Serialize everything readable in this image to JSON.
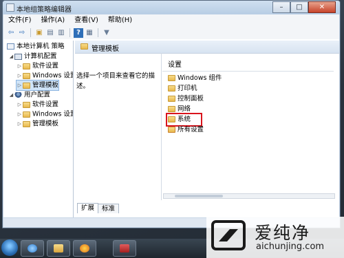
{
  "window": {
    "title": "本地组策略编辑器",
    "controls": {
      "minimize": "–",
      "maximize": "□",
      "close": "✕"
    }
  },
  "menubar": [
    {
      "label": "文件(F)"
    },
    {
      "label": "操作(A)"
    },
    {
      "label": "查看(V)"
    },
    {
      "label": "帮助(H)"
    }
  ],
  "toolbar": [
    {
      "icon": "back-arrow-icon",
      "glyph": "⇦"
    },
    {
      "icon": "forward-arrow-icon",
      "glyph": "⇨"
    },
    {
      "icon": "up-folder-icon",
      "glyph": "▣"
    },
    {
      "icon": "show-hide-tree-icon",
      "glyph": "▤"
    },
    {
      "icon": "export-list-icon",
      "glyph": "▥"
    },
    {
      "icon": "help-icon",
      "glyph": "?"
    },
    {
      "icon": "properties-icon",
      "glyph": "▦"
    },
    {
      "icon": "filter-icon",
      "glyph": "▼"
    }
  ],
  "tree": [
    {
      "label": "本地计算机 策略",
      "icon": "policy-icon",
      "indent": 0,
      "arrow": ""
    },
    {
      "label": "计算机配置",
      "icon": "computer-icon",
      "indent": 1,
      "arrow": "◢"
    },
    {
      "label": "软件设置",
      "icon": "folder-icon",
      "indent": 2,
      "arrow": "▷"
    },
    {
      "label": "Windows 设置",
      "icon": "folder-icon",
      "indent": 2,
      "arrow": "▷"
    },
    {
      "label": "管理模板",
      "icon": "folder-icon",
      "indent": 2,
      "arrow": "▷",
      "selected": true
    },
    {
      "label": "用户配置",
      "icon": "user-icon",
      "indent": 1,
      "arrow": "◢"
    },
    {
      "label": "软件设置",
      "icon": "folder-icon",
      "indent": 2,
      "arrow": "▷"
    },
    {
      "label": "Windows 设置",
      "icon": "folder-icon",
      "indent": 2,
      "arrow": "▷"
    },
    {
      "label": "管理模板",
      "icon": "folder-icon",
      "indent": 2,
      "arrow": "▷"
    }
  ],
  "main": {
    "section_title": "管理模板",
    "description": "选择一个项目来查看它的描述。",
    "list_header": "设置",
    "items": [
      {
        "label": "Windows 组件",
        "icon": "folder-icon"
      },
      {
        "label": "打印机",
        "icon": "folder-icon"
      },
      {
        "label": "控制面板",
        "icon": "folder-icon"
      },
      {
        "label": "网络",
        "icon": "folder-icon"
      },
      {
        "label": "系统",
        "icon": "folder-icon",
        "highlighted": true
      },
      {
        "label": "所有设置",
        "icon": "all-settings-icon"
      }
    ],
    "tabs": [
      {
        "label": "扩展",
        "active": true
      },
      {
        "label": "标准",
        "active": false
      }
    ]
  },
  "watermark": {
    "brand": "爱纯净",
    "url": "aichunjing.com"
  },
  "colors": {
    "highlight_box": "#d9141c",
    "selection": "#cfe4f8",
    "folder": "#e8b84d"
  }
}
